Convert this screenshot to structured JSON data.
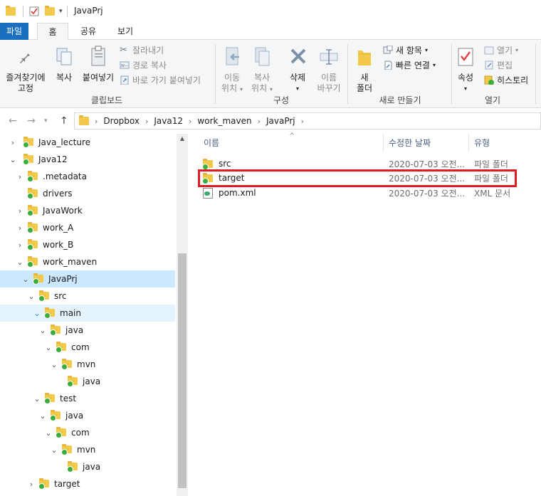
{
  "window": {
    "title": "JavaPrj"
  },
  "tabs": [
    {
      "label": "파일"
    },
    {
      "label": "홈"
    },
    {
      "label": "공유"
    },
    {
      "label": "보기"
    }
  ],
  "ribbon": {
    "clipboard": {
      "pin_line1": "즐겨찾기에",
      "pin_line2": "고정",
      "copy": "복사",
      "paste": "붙여넣기",
      "cut": "잘라내기",
      "copy_path": "경로 복사",
      "paste_shortcut": "바로 가기 붙여넣기",
      "label": "클립보드"
    },
    "organize": {
      "move_line1": "이동",
      "move_line2": "위치",
      "copy_line1": "복사",
      "copy_line2": "위치",
      "delete": "삭제",
      "rename_line1": "이름",
      "rename_line2": "바꾸기",
      "label": "구성"
    },
    "new": {
      "new_folder_line1": "새",
      "new_folder_line2": "폴더",
      "new_item": "새 항목",
      "easy_access": "빠른 연결",
      "label": "새로 만들기"
    },
    "open": {
      "properties": "속성",
      "open": "열기",
      "edit": "편집",
      "history": "히스토리",
      "label": "열기"
    }
  },
  "address": {
    "crumbs": [
      "Dropbox",
      "Java12",
      "work_maven",
      "JavaPrj"
    ]
  },
  "tree": [
    {
      "label": "Java_lecture"
    },
    {
      "label": "Java12"
    },
    {
      "label": ".metadata"
    },
    {
      "label": "drivers"
    },
    {
      "label": "JavaWork"
    },
    {
      "label": "work_A"
    },
    {
      "label": "work_B"
    },
    {
      "label": "work_maven"
    },
    {
      "label": "JavaPrj"
    },
    {
      "label": "src"
    },
    {
      "label": "main"
    },
    {
      "label": "java"
    },
    {
      "label": "com"
    },
    {
      "label": "mvn"
    },
    {
      "label": "java"
    },
    {
      "label": "test"
    },
    {
      "label": "java"
    },
    {
      "label": "com"
    },
    {
      "label": "mvn"
    },
    {
      "label": "java"
    },
    {
      "label": "target"
    }
  ],
  "list": {
    "headers": {
      "name": "이름",
      "date": "수정한 날짜",
      "type": "유형"
    },
    "rows": [
      {
        "name": "src",
        "date": "2020-07-03 오전...",
        "type": "파일 폴더"
      },
      {
        "name": "target",
        "date": "2020-07-03 오전...",
        "type": "파일 폴더"
      },
      {
        "name": "pom.xml",
        "date": "2020-07-03 오전...",
        "type": "XML 문서"
      }
    ]
  },
  "colors": {
    "file_tab": "#1a6fc1",
    "selection": "#cce8ff",
    "highlight_box": "#e01b24",
    "folder": "#f3c94c",
    "sync_check": "#3cae3c"
  }
}
